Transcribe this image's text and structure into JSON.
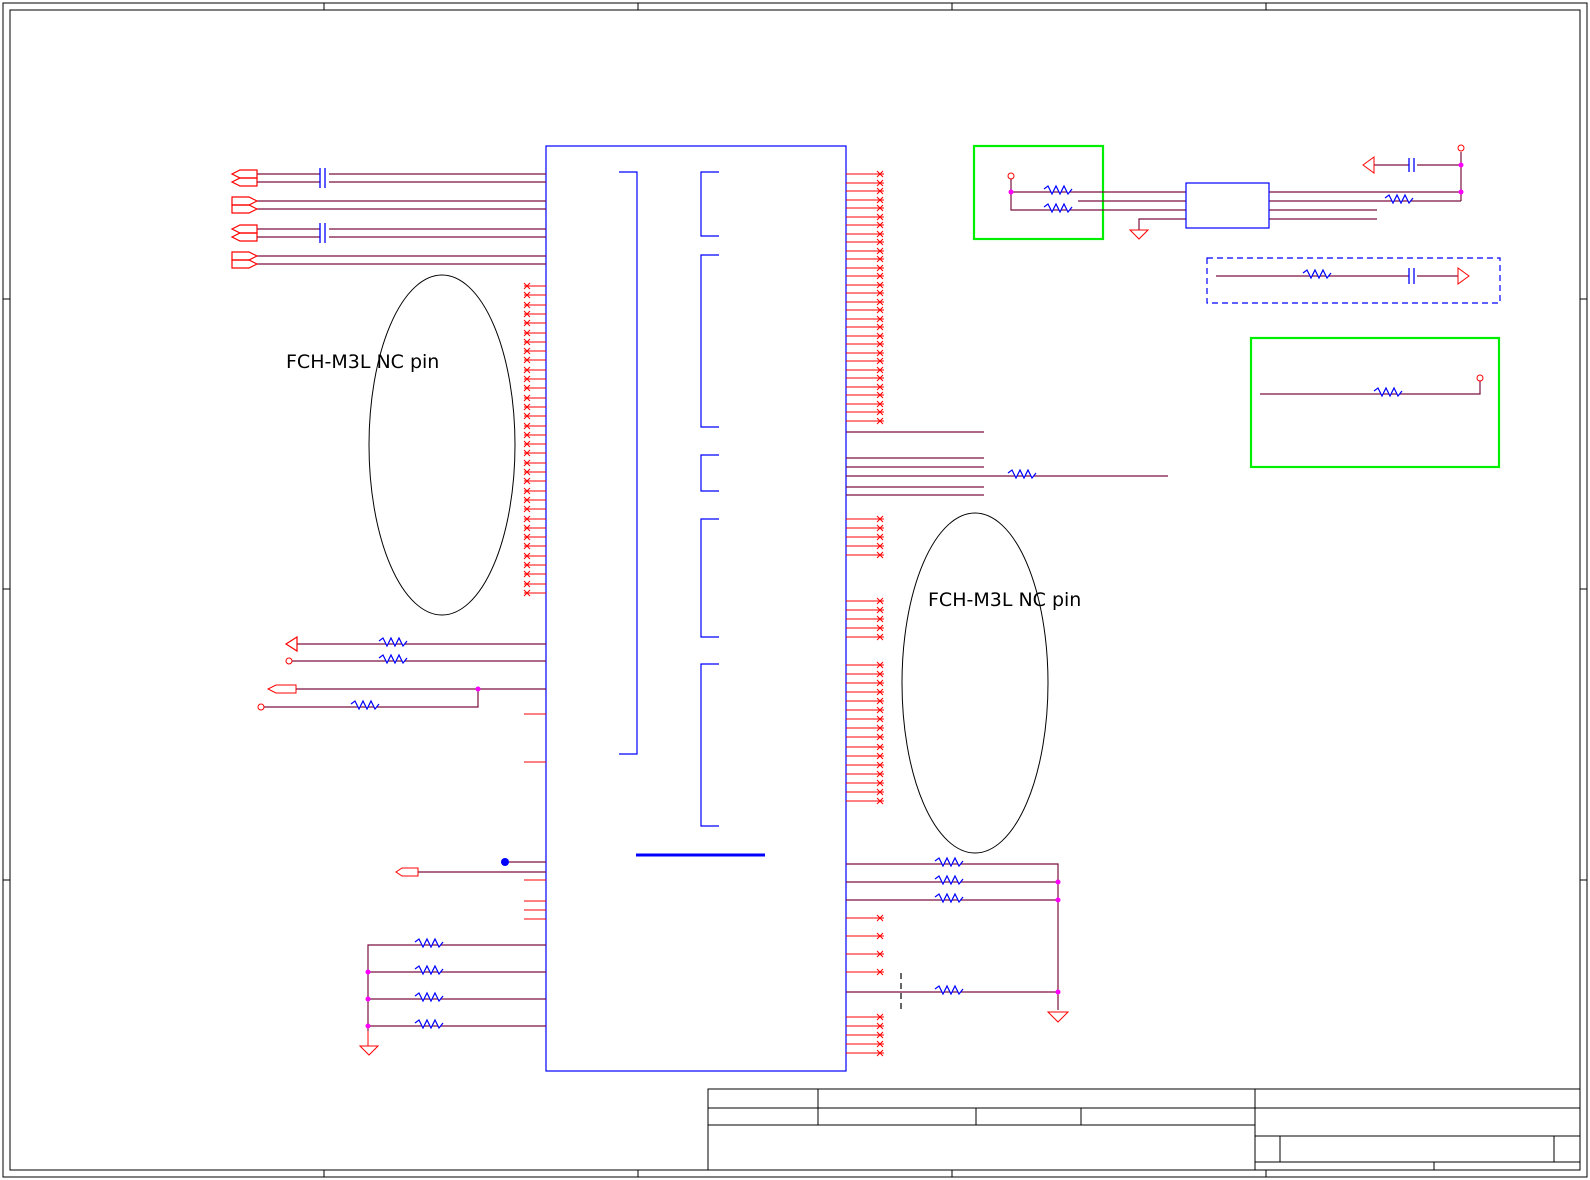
{
  "colors": {
    "wire": "#7a1040",
    "pin": "#ff0000",
    "part": "#0000ff",
    "junction": "#ff00ff",
    "highlight": "#00ee00",
    "frame": "#000000"
  },
  "annotations": {
    "left_nc_label": "FCH-M3L NC pin",
    "right_nc_label": "FCH-M3L NC pin"
  },
  "icons": [
    "resistor-icon",
    "capacitor-icon",
    "ground-icon",
    "off-page-connector-icon",
    "power-pin-icon"
  ]
}
